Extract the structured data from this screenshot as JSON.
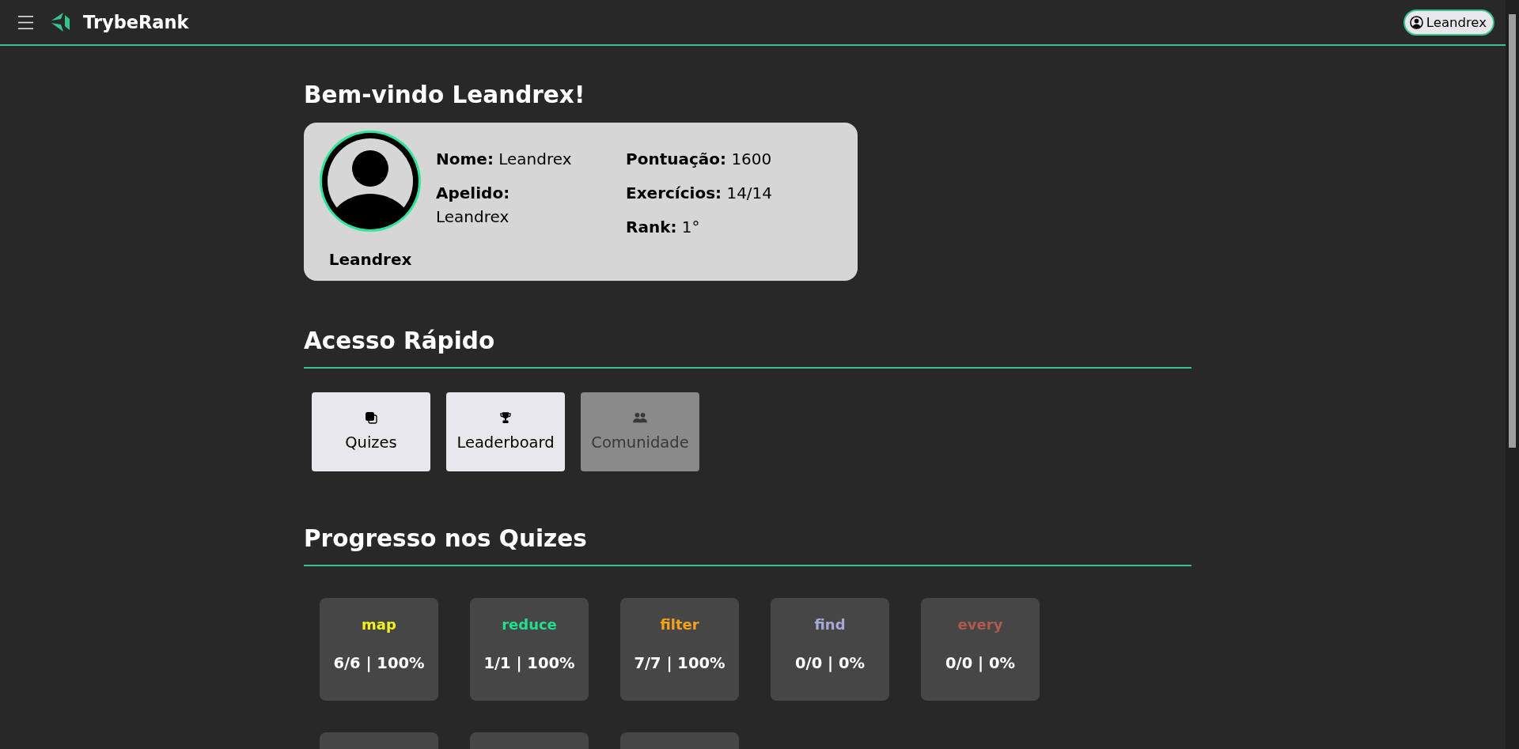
{
  "navbar": {
    "brand": "TrybeRank",
    "user": "Leandrex"
  },
  "welcome": {
    "title": "Bem-vindo Leandrex!"
  },
  "profile": {
    "name": "Leandrex",
    "columns": [
      {
        "fields": [
          {
            "label": "Nome:",
            "value": "Leandrex"
          },
          {
            "label": "Apelido:",
            "value": "Leandrex"
          }
        ]
      },
      {
        "fields": [
          {
            "label": "Pontuação:",
            "value": "1600"
          },
          {
            "label": "Exercícios:",
            "value": "14/14"
          },
          {
            "label": "Rank:",
            "value": "1°"
          }
        ]
      }
    ]
  },
  "quick_access": {
    "title": "Acesso Rápido",
    "buttons": [
      {
        "label": "Quizes",
        "disabled": false
      },
      {
        "label": "Leaderboard",
        "disabled": false
      },
      {
        "label": "Comunidade",
        "disabled": true
      }
    ]
  },
  "quiz_progress": {
    "title": "Progresso nos Quizes",
    "quizzes": [
      {
        "kind": "full",
        "name": "map",
        "color": "#f2f21e",
        "score": "6/6 | 100%"
      },
      {
        "kind": "full",
        "name": "reduce",
        "color": "#22df8e",
        "score": "1/1 | 100%"
      },
      {
        "kind": "full",
        "name": "filter",
        "color": "#f8a11c",
        "score": "7/7 | 100%"
      },
      {
        "kind": "full",
        "name": "find",
        "color": "#a6a8d6",
        "score": "0/0 | 0%"
      },
      {
        "kind": "full",
        "name": "every",
        "color": "#b05a4e",
        "score": "0/0 | 0%"
      },
      {
        "kind": "partial"
      },
      {
        "kind": "partial"
      },
      {
        "kind": "partial"
      }
    ]
  }
}
